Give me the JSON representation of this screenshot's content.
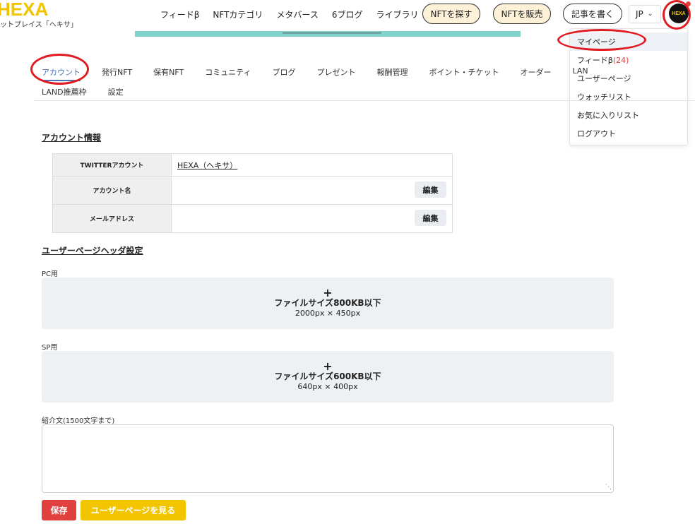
{
  "header": {
    "logo": "HEXA",
    "logo_sub": "ットプレイス「ヘキサ」",
    "nav": [
      "フィードβ",
      "NFTカテゴリ",
      "メタバース",
      "6ブログ",
      "ライブラリ"
    ],
    "find_nft": "NFTを探す",
    "sell_nft": "NFTを販売",
    "write_article": "記事を書く",
    "lang": "JP",
    "avatar_text": "HEXA"
  },
  "dropdown": {
    "mypage": "マイページ",
    "feed": "フィードβ",
    "feed_count": "(24)",
    "user_page": "ユーザーページ",
    "watchlist": "ウォッチリスト",
    "favorites": "お気に入りリスト",
    "logout": "ログアウト"
  },
  "tabs": {
    "row1": [
      "アカウント",
      "発行NFT",
      "保有NFT",
      "コミュニティ",
      "ブログ",
      "プレゼント",
      "報酬管理",
      "ポイント・チケット",
      "オーダー",
      "LAN"
    ],
    "row2": [
      "LAND推薦枠",
      "設定"
    ]
  },
  "account": {
    "section_title": "アカウント情報",
    "twitter_label": "TWITTERアカウント",
    "twitter_value": "HEXA（ヘキサ）",
    "name_label": "アカウント名",
    "email_label": "メールアドレス",
    "edit": "編集"
  },
  "header_settings": {
    "section_title": "ユーザーページヘッダ設定",
    "pc_label": "PC用",
    "pc_plus": "+",
    "pc_size": "ファイルサイズ800KB以下",
    "pc_dim": "2000px × 450px",
    "sp_label": "SP用",
    "sp_plus": "+",
    "sp_size": "ファイルサイズ600KB以下",
    "sp_dim": "640px × 400px",
    "bio_label": "紹介文(1500文字まで)"
  },
  "actions": {
    "save": "保存",
    "view_user_page": "ユーザーページを見る"
  },
  "colors": {
    "brand_yellow": "#f2c300",
    "save_red": "#e0413f",
    "active_tab": "#4a73b5",
    "annotation_red": "#e11b22"
  }
}
